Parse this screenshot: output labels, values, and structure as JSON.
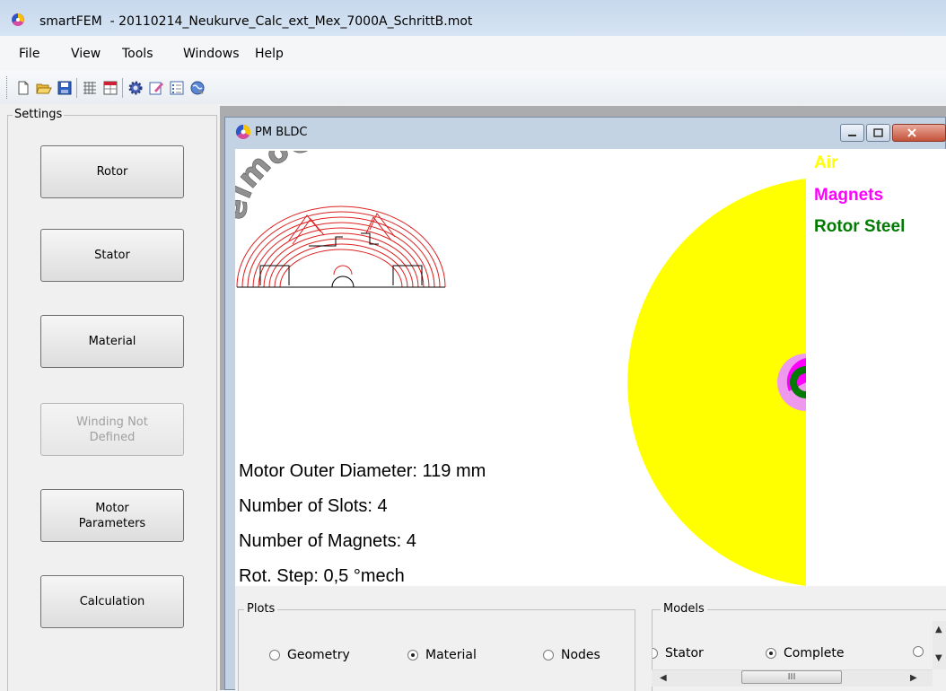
{
  "window": {
    "app_name": "smartFEM",
    "title": "smartFEM  - 20110214_Neukurve_Calc_ext_Mex_7000A_SchrittB.mot"
  },
  "menu": [
    "File",
    "View",
    "Tools",
    "Windows",
    "Help"
  ],
  "toolbar_icons": [
    "new-icon",
    "open-icon",
    "save-icon",
    "mesh-icon",
    "table-icon",
    "settings-gear-icon",
    "edit-icon",
    "list-icon",
    "globe-icon"
  ],
  "settings": {
    "legend": "Settings",
    "buttons": [
      {
        "label": "Rotor",
        "enabled": true
      },
      {
        "label": "Stator",
        "enabled": true
      },
      {
        "label": "Material",
        "enabled": true
      },
      {
        "label": "Winding Not\nDefined",
        "enabled": false
      },
      {
        "label": "Motor\nParameters",
        "enabled": true
      },
      {
        "label": "Calculation",
        "enabled": true
      }
    ]
  },
  "child_window": {
    "title": "PM BLDC"
  },
  "logo": {
    "text": "elmoCAD"
  },
  "info": {
    "outer_diameter": "Motor Outer Diameter: 119 mm",
    "slots": "Number of Slots: 4",
    "magnets": "Number of Magnets: 4",
    "rot_step": "Rot. Step: 0,5 °mech"
  },
  "legend": [
    {
      "label": "Air",
      "color": "#ffff00"
    },
    {
      "label": "Magnets",
      "color": "#ff00ff"
    },
    {
      "label": "Rotor Steel",
      "color": "#007a00"
    }
  ],
  "plots": {
    "legend": "Plots",
    "options": [
      {
        "label": "Geometry",
        "checked": false
      },
      {
        "label": "Material",
        "checked": true
      },
      {
        "label": "Nodes",
        "checked": false
      }
    ]
  },
  "models": {
    "legend": "Models",
    "options": [
      {
        "label": "Stator",
        "checked": false
      },
      {
        "label": "Complete",
        "checked": true
      }
    ],
    "scroll_thumb": "III"
  },
  "colors": {
    "air": "#ffff00",
    "magnets": "#ff00ff",
    "magnets_light": "#ee99ee",
    "rotor_steel": "#007a00",
    "logo_lines": "#dd2020",
    "logo_text": "#909090"
  }
}
